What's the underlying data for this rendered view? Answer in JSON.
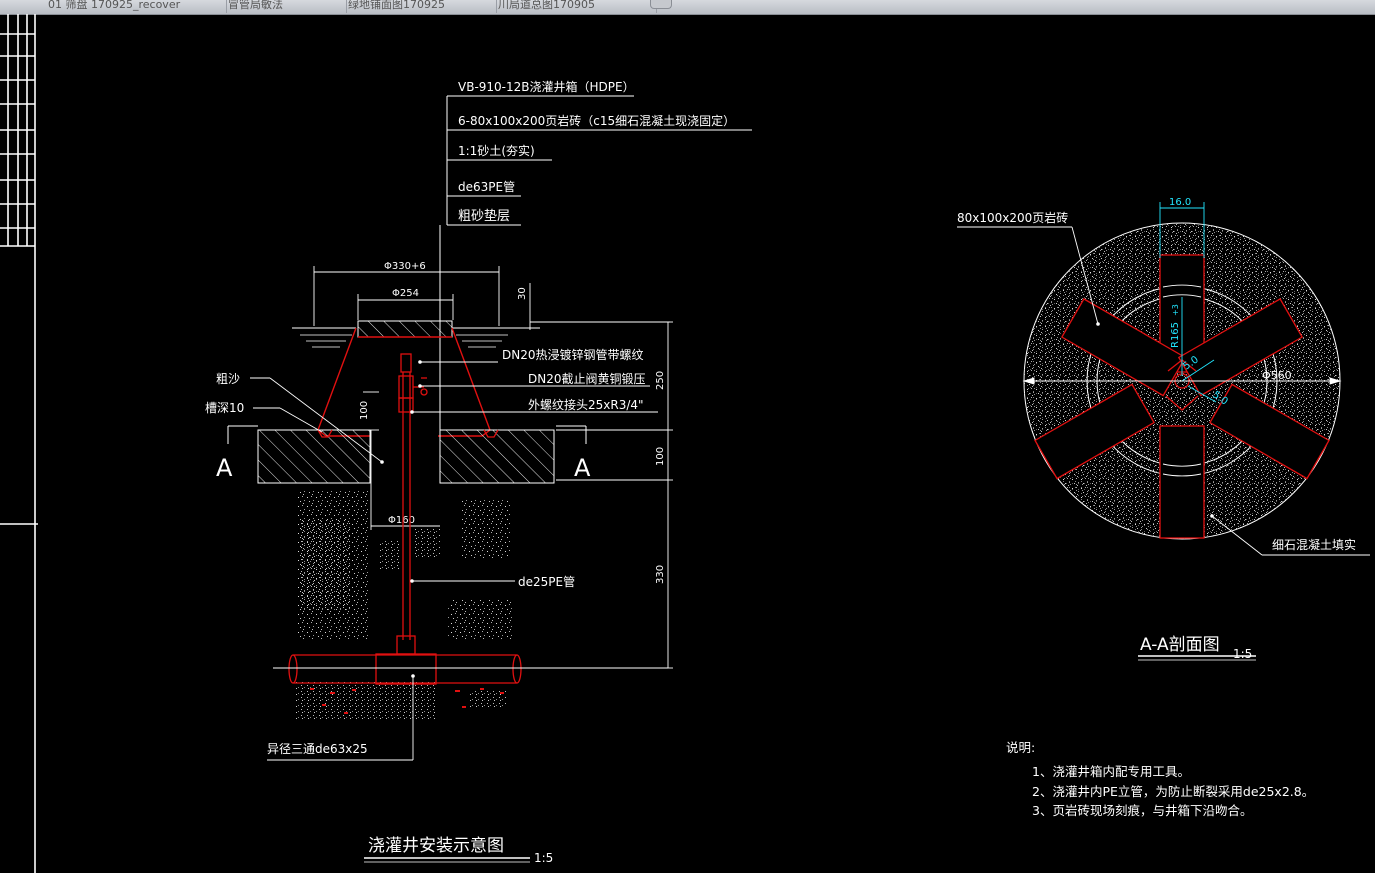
{
  "tabs": [
    {
      "label": "01 筛盘 170925_recover"
    },
    {
      "label": "冒管局敏法"
    },
    {
      "label": "绿地铺面图170925"
    },
    {
      "label": "川局道总图170905"
    }
  ],
  "drawing": {
    "left_view": {
      "callouts": [
        "VB-910-12B浇灌井箱（HDPE）",
        "6-80x100x200页岩砖（c15细石混凝土现浇固定）",
        "1:1砂土(夯实)",
        "de63PE管",
        "粗砂垫层"
      ],
      "dims": {
        "phi330": "Φ330+6",
        "phi254": "Φ254",
        "d30": "30",
        "d250": "250",
        "d100a": "100",
        "d100b": "100",
        "d330": "330",
        "phi160": "Φ160"
      },
      "labels": {
        "dn20_pipe": "DN20热浸镀锌钢管带螺纹",
        "dn20_valve": "DN20截止阀黄铜锻压",
        "thread": "外螺纹接头25xR3/4\"",
        "sand": "粗沙",
        "groove": "槽深10",
        "section_a_left": "A",
        "section_a_right": "A",
        "de25": "de25PE管",
        "tee": "异径三通de63x25"
      },
      "title": "浇灌井安装示意图",
      "scale": "1:5"
    },
    "right_view": {
      "brick_label": "80x100x200页岩砖",
      "dim_16": "16.0",
      "dim_r165": "R165",
      "dim_r165_tol": "+3",
      "dim_phi560": "Φ560",
      "dim_5a": "5.0",
      "dim_5b": "5.0",
      "fill_label": "细石混凝土填实",
      "title": "A-A剖面图",
      "scale": "1:5"
    },
    "notes": {
      "heading": "说明:",
      "items": [
        "1、浇灌井箱内配专用工具。",
        "2、浇灌井内PE立管，为防止断裂采用de25x2.8。",
        "3、页岩砖现场刻痕，与井箱下沿吻合。"
      ]
    },
    "colors": {
      "background": "#000000",
      "red": "#e01010",
      "white": "#ffffff",
      "cyan": "#22e6ff"
    }
  }
}
